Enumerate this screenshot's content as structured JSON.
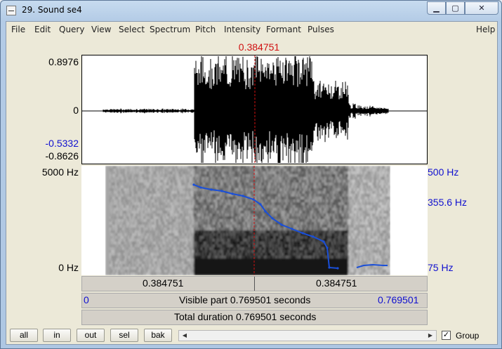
{
  "window": {
    "title": "29. Sound se4",
    "min_glyph": "▁",
    "max_glyph": "▢",
    "close_glyph": "✕"
  },
  "menu": [
    "File",
    "Edit",
    "Query",
    "View",
    "Select",
    "Spectrum",
    "Pitch",
    "Intensity",
    "Formant",
    "Pulses",
    "Help"
  ],
  "editor": {
    "cursor_time": "0.384751",
    "wave_max": "0.8976",
    "wave_zero": "0",
    "wave_sel_min": "-0.5332",
    "wave_min": "-0.8626",
    "spec_max": "5000 Hz",
    "spec_min": "0 Hz",
    "pitch_max": "500 Hz",
    "pitch_mid": "355.6 Hz",
    "pitch_min": "75 Hz",
    "row1_left": "0.384751",
    "row1_right": "0.384751",
    "row2_start": "0",
    "row2_center": "Visible part 0.769501 seconds",
    "row2_end": "0.769501",
    "row3_center": "Total duration 0.769501 seconds"
  },
  "toolbar": {
    "all": "all",
    "in": "in",
    "out": "out",
    "sel": "sel",
    "bak": "bak",
    "scroll_left": "◀",
    "scroll_right": "▶",
    "group_check": "✓",
    "group_label": "Group"
  },
  "colors": {
    "cursor": "#d01010",
    "pitch": "#1010d0",
    "pitch_line": "#1a4fd8"
  }
}
